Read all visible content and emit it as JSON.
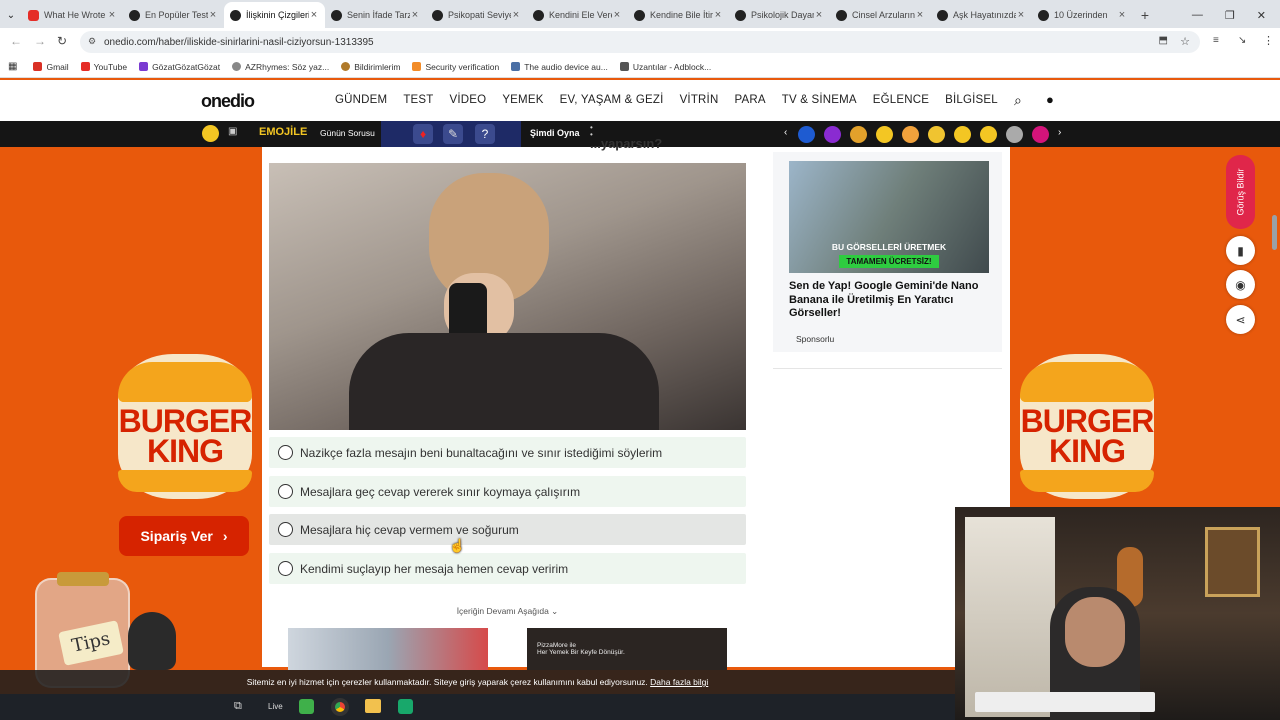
{
  "browser": {
    "tabs": [
      {
        "title": "What He Wrote",
        "icon": "youtube-icon"
      },
      {
        "title": "En Popüler Testler",
        "icon": "onedio-icon"
      },
      {
        "title": "İlişkinin Çizgileri",
        "icon": "onedio-icon"
      },
      {
        "title": "Senin İfade Tarzın",
        "icon": "onedio-icon"
      },
      {
        "title": "Psikopati Seviyen",
        "icon": "onedio-icon"
      },
      {
        "title": "Kendini Ele Veren",
        "icon": "onedio-icon"
      },
      {
        "title": "Kendine Bile İtiraf",
        "icon": "onedio-icon"
      },
      {
        "title": "Psikolojik Dayanıklılık",
        "icon": "onedio-icon"
      },
      {
        "title": "Cinsel Arzuların",
        "icon": "onedio-icon"
      },
      {
        "title": "Aşk Hayatınızda",
        "icon": "onedio-icon"
      },
      {
        "title": "10 Üzerinden",
        "icon": "onedio-icon"
      }
    ],
    "url": "onedio.com/haber/iliskide-sinirlarini-nasil-ciziyorsun-1313395",
    "bookmarks": [
      "Gmail",
      "YouTube",
      "GözatGözatGözat",
      "AZRhymes: Söz yaz...",
      "Bildirimlerim",
      "Security verification",
      "The audio device au...",
      "Uzantılar - Adblock..."
    ]
  },
  "site": {
    "logo": "onedio",
    "nav": [
      "GÜNDEM",
      "TEST",
      "VİDEO",
      "YEMEK",
      "EV, YAŞAM & GEZİ",
      "VİTRİN",
      "PARA",
      "TV & SİNEMA",
      "EĞLENCE",
      "BİLGİSEL"
    ]
  },
  "emojibar": {
    "game": "EMOJİLE",
    "label": "Günün Sorusu",
    "play": "Şimdi Oyna",
    "question_mark": "?"
  },
  "question_partial": "...yaparsın?",
  "options": [
    "Nazikçe fazla mesajın beni bunaltacağını ve sınır istediğimi söylerim",
    "Mesajlara geç cevap vererek sınır koymaya çalışırım",
    "Mesajlara hiç cevap vermem ve soğurum",
    "Kendimi suçlayıp her mesaja hemen cevap veririm"
  ],
  "continue_label": "İçeriğin Devamı Aşağıda ⌄",
  "sidebar_ad": {
    "img_line1": "BU GÖRSELLERİ ÜRETMEK",
    "img_line2": "TAMAMEN ÜCRETSİZ!",
    "title": "Sen de Yap! Google Gemini'de Nano Banana ile Üretilmiş En Yaratıcı Görseller!",
    "sponsor": "Sponsorlu"
  },
  "feedback": "Görüş Bildir",
  "burger": {
    "brand_line1": "BURGER",
    "brand_line2": "KING",
    "cta": "Sipariş Ver"
  },
  "pizza_ad": {
    "line1": "PizzaMore ile",
    "line2": "Her Yemek Bir Keyfe Dönüşür."
  },
  "cookie": {
    "text": "Sitemiz en iyi hizmet için çerezler kullanmaktadır. Siteye giriş yaparak çerez kullanımını kabul ediyorsunuz.",
    "link": "Daha fazla bilgi"
  },
  "tips": "Tips",
  "taskbar": {
    "item": "Live"
  },
  "colors": {
    "orange": "#e8590c",
    "bk_red": "#d62300",
    "option_bg": "#eef6ef"
  }
}
